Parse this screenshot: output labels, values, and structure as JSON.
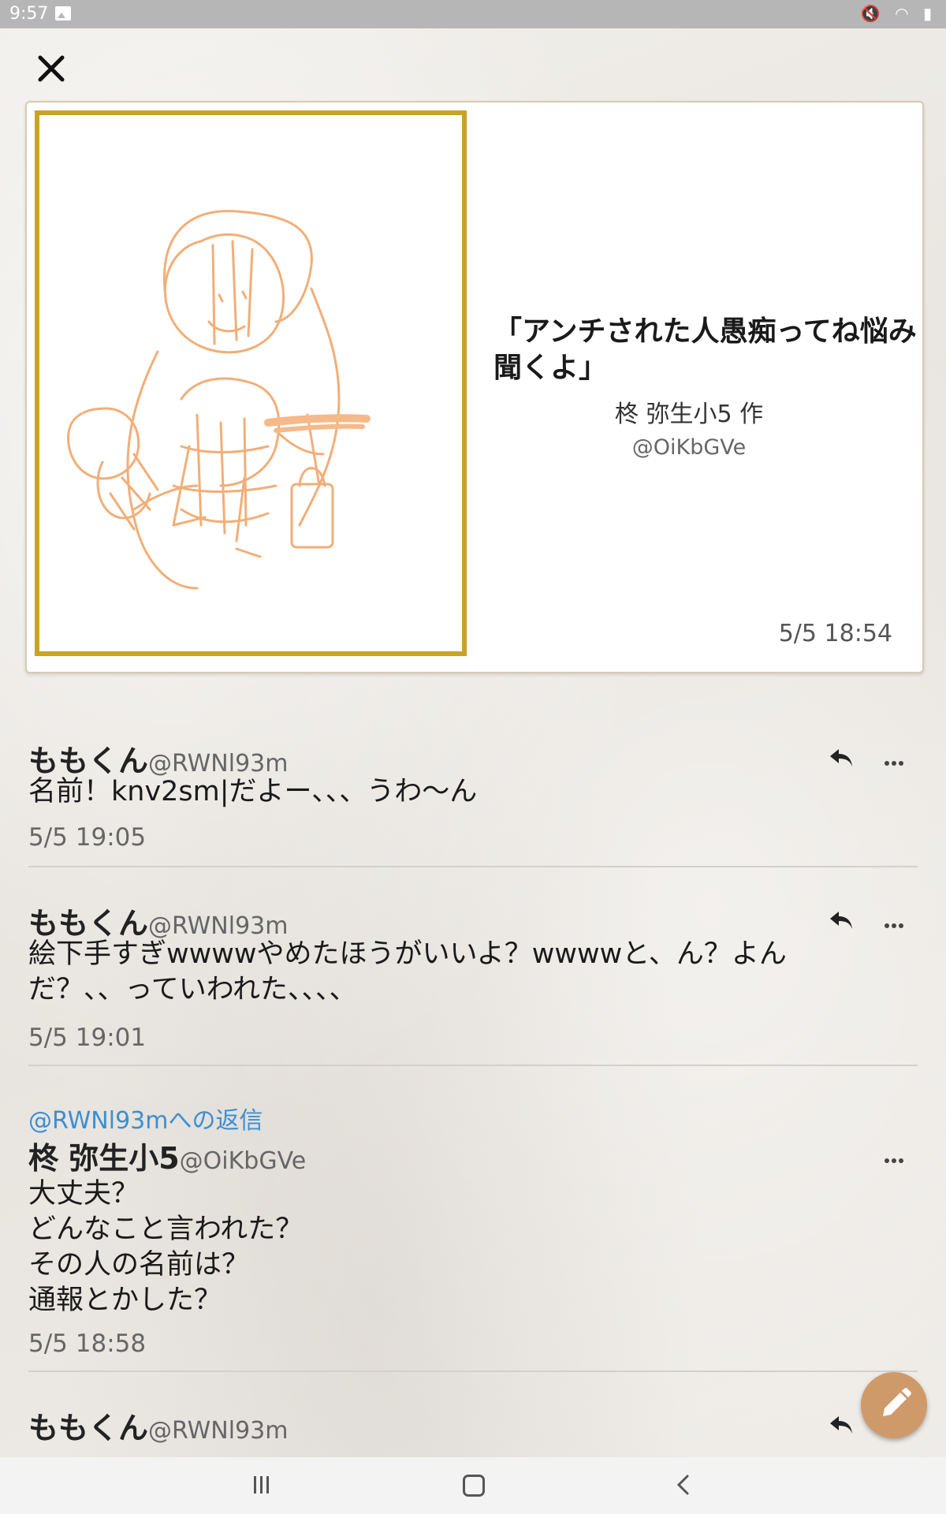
{
  "status_bar": {
    "time": "9:57",
    "right_icons": "🔇 ◠ ▮"
  },
  "post": {
    "title": "「アンチされた人愚痴ってね悩み聞くよ」",
    "author": "柊 弥生小5 作",
    "handle": "@OiKbGVe",
    "date": "5/5 18:54"
  },
  "comments": [
    {
      "name": "ももくん",
      "handle": "@RWNl93m",
      "body": "名前！knv2sm|だよー、、、うわ〜ん",
      "date": "5/5 19:05"
    },
    {
      "name": "ももくん",
      "handle": "@RWNl93m",
      "body": "絵下手すぎwwwwやめたほうがいいよ？wwwwと、ん？よんだ？、、っていわれた、、、、",
      "date": "5/5 19:01"
    },
    {
      "reply_to": "@RWNl93mへの返信",
      "name": "柊 弥生小5",
      "handle": "@OiKbGVe",
      "body_lines": [
        "大丈夫？",
        "どんなこと言われた？",
        "その人の名前は？",
        "通報とかした？"
      ],
      "date": "5/5 18:58"
    },
    {
      "name": "ももくん",
      "handle": "@RWNl93m"
    }
  ],
  "colors": {
    "accent": "#cf9a6a",
    "frame": "#c9a227",
    "link": "#3d8fd1"
  }
}
